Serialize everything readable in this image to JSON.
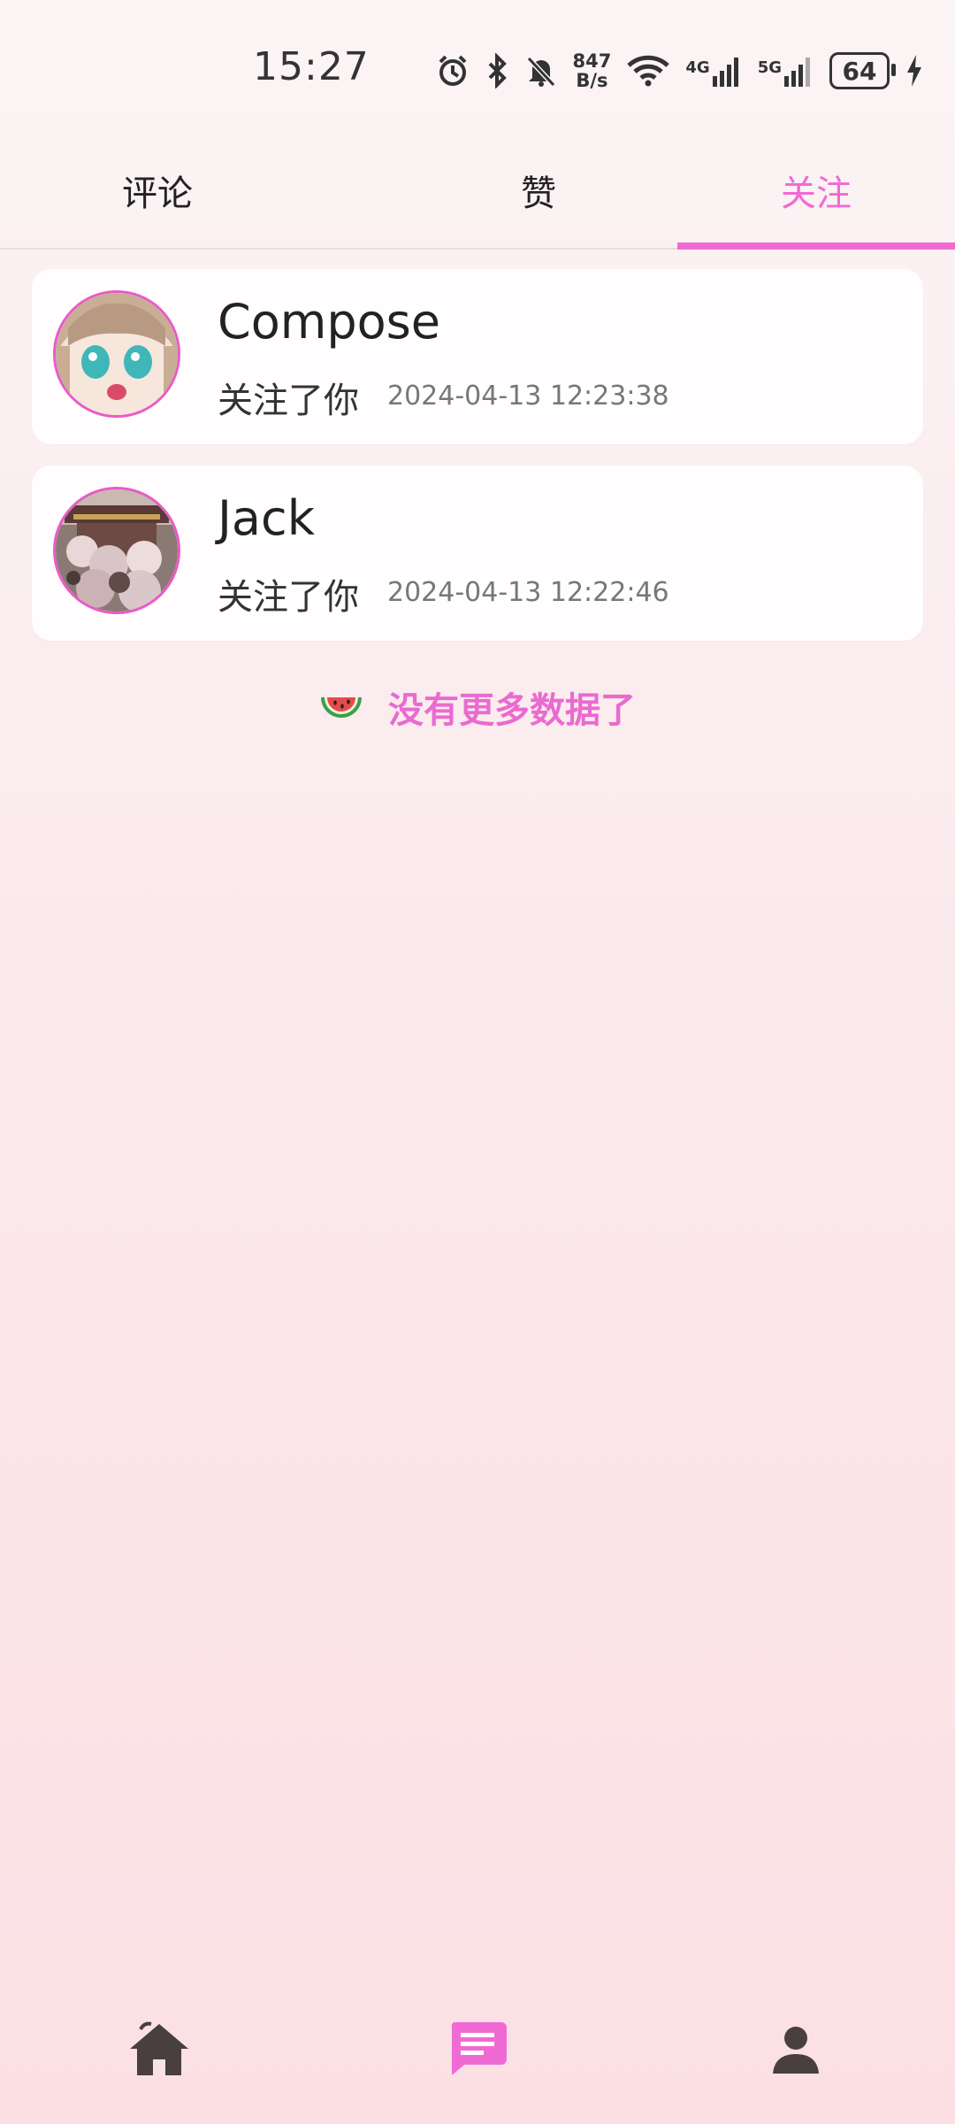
{
  "status_bar": {
    "time": "15:27",
    "speed_value": "847",
    "speed_unit": "B/s",
    "net1": "4G",
    "net2": "5G",
    "battery": "64"
  },
  "tabs": [
    {
      "label": "评论",
      "active": false
    },
    {
      "label": "赞",
      "active": false
    },
    {
      "label": "关注",
      "active": true
    }
  ],
  "follows": [
    {
      "name": "Compose",
      "action": "关注了你",
      "time": "2024-04-13 12:23:38",
      "avatar": "anime-girl-avatar"
    },
    {
      "name": "Jack",
      "action": "关注了你",
      "time": "2024-04-13 12:22:46",
      "avatar": "blossom-building-avatar"
    }
  ],
  "footer_message": "没有更多数据了",
  "bottom_nav": [
    {
      "icon": "home-icon"
    },
    {
      "icon": "message-icon",
      "active": true
    },
    {
      "icon": "profile-icon"
    }
  ],
  "colors": {
    "accent": "#f06ad4",
    "icon_dark": "#4a3f40"
  }
}
